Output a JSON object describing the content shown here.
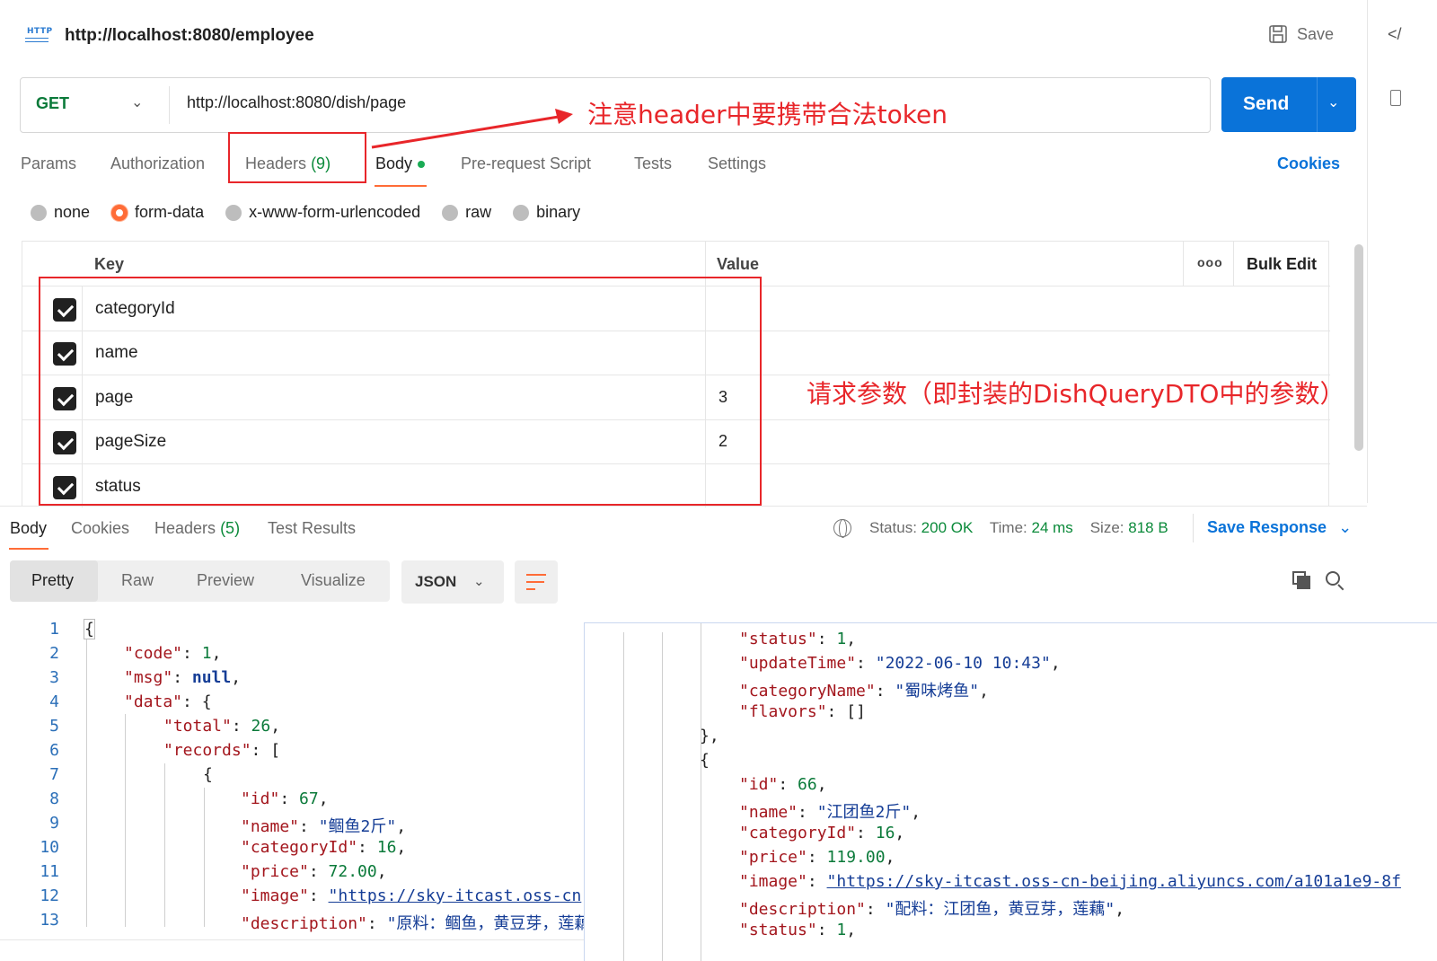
{
  "header": {
    "http_badge": "HTTP",
    "request_title": "http://localhost:8080/employee",
    "save_label": "Save",
    "code_toggle": "</"
  },
  "request": {
    "method": "GET",
    "url": "http://localhost:8080/dish/page",
    "send_label": "Send"
  },
  "request_tabs": {
    "params": "Params",
    "authorization": "Authorization",
    "headers": "Headers",
    "headers_count": "(9)",
    "body": "Body",
    "pre_request": "Pre-request Script",
    "tests": "Tests",
    "settings": "Settings",
    "cookies": "Cookies"
  },
  "body_types": {
    "none": "none",
    "form_data": "form-data",
    "urlencoded": "x-www-form-urlencoded",
    "raw": "raw",
    "binary": "binary",
    "selected": "form-data"
  },
  "params_table": {
    "key_header": "Key",
    "value_header": "Value",
    "more": "ooo",
    "bulk_edit": "Bulk Edit",
    "rows": [
      {
        "key": "categoryId",
        "value": "",
        "checked": true
      },
      {
        "key": "name",
        "value": "",
        "checked": true
      },
      {
        "key": "page",
        "value": "3",
        "checked": true
      },
      {
        "key": "pageSize",
        "value": "2",
        "checked": true
      },
      {
        "key": "status",
        "value": "",
        "checked": true
      }
    ]
  },
  "annotations": {
    "header_note": "注意header中要携带合法token",
    "params_note": "请求参数（即封装的DishQueryDTO中的参数）",
    "color": "#e8262a"
  },
  "response_tabs": {
    "body": "Body",
    "cookies": "Cookies",
    "headers": "Headers",
    "headers_count": "(5)",
    "test_results": "Test Results"
  },
  "response_status": {
    "status_label": "Status:",
    "status_value": "200 OK",
    "time_label": "Time:",
    "time_value": "24 ms",
    "size_label": "Size:",
    "size_value": "818 B",
    "save_response": "Save Response"
  },
  "view_modes": {
    "pretty": "Pretty",
    "raw": "Raw",
    "preview": "Preview",
    "visualize": "Visualize",
    "format": "JSON"
  },
  "response_code_left": {
    "line_numbers": [
      "1",
      "2",
      "3",
      "4",
      "5",
      "6",
      "7",
      "8",
      "9",
      "10",
      "11",
      "12",
      "13"
    ],
    "lines": {
      "brace_open": "{",
      "code_key": "\"code\"",
      "code_val": "1",
      "msg_key": "\"msg\"",
      "msg_val": "null",
      "data_key": "\"data\"",
      "total_key": "\"total\"",
      "total_val": "26",
      "records_key": "\"records\"",
      "rec_open": "{",
      "id_key": "\"id\"",
      "id_val": "67",
      "name_key": "\"name\"",
      "name_val": "\"鲴鱼2斤\"",
      "cat_key": "\"categoryId\"",
      "cat_val": "16",
      "price_key": "\"price\"",
      "price_val": "72.00",
      "image_key": "\"image\"",
      "image_val": "\"https://sky-itcast.oss-cn",
      "desc_key": "\"description\"",
      "desc_val": "\"原料：鲴鱼，黄豆芽，莲藕"
    }
  },
  "response_code_right": {
    "status_key": "\"status\"",
    "status_val": "1",
    "update_key": "\"updateTime\"",
    "update_val": "\"2022-06-10 10:43\"",
    "catname_key": "\"categoryName\"",
    "catname_val": "\"蜀味烤鱼\"",
    "flavors_key": "\"flavors\"",
    "flavors_val": "[]",
    "close_brace": "},",
    "open_brace": "{",
    "id_key": "\"id\"",
    "id_val": "66",
    "name_key": "\"name\"",
    "name_val": "\"江团鱼2斤\"",
    "cat_key": "\"categoryId\"",
    "cat_val": "16",
    "price_key": "\"price\"",
    "price_val": "119.00",
    "image_key": "\"image\"",
    "image_val": "\"https://sky-itcast.oss-cn-beijing.aliyuncs.com/a101a1e9-8f",
    "desc_key": "\"description\"",
    "desc_val": "\"配料：江团鱼，黄豆芽，莲藕\"",
    "status2_key": "\"status\"",
    "status2_val": "1"
  }
}
